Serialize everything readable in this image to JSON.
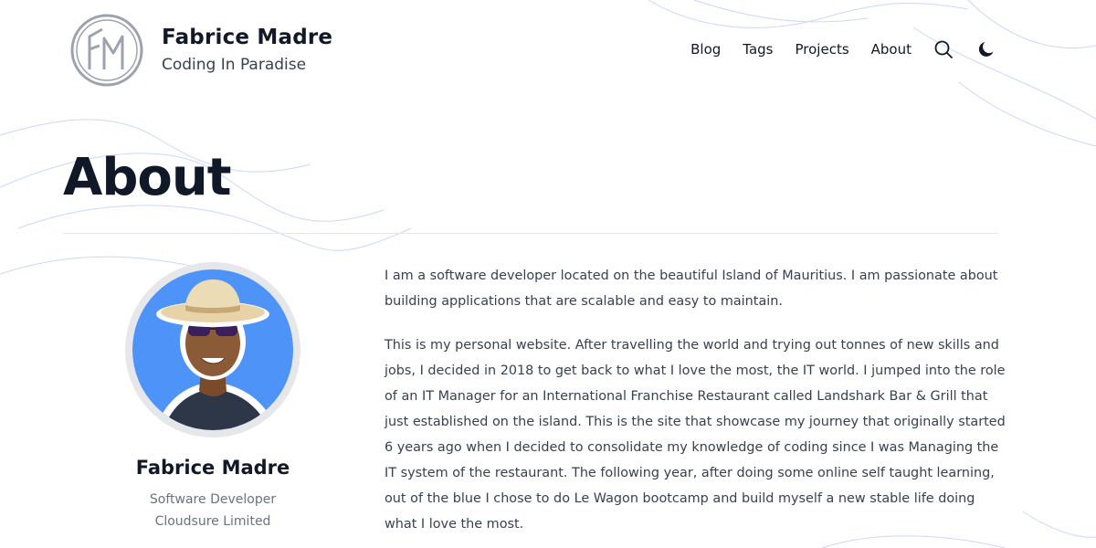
{
  "site": {
    "title": "Fabrice Madre",
    "tagline": "Coding In Paradise",
    "logo_icon": "fm-monogram-logo"
  },
  "nav": {
    "items": [
      "Blog",
      "Tags",
      "Projects",
      "About"
    ],
    "search_icon": "search-icon",
    "theme_icon": "moon-icon"
  },
  "page": {
    "title": "About"
  },
  "profile": {
    "name": "Fabrice Madre",
    "role": "Software Developer",
    "company": "Cloudsure Limited",
    "avatar_bg": "#4e93f7"
  },
  "content": {
    "paragraphs": [
      "I am a software developer located on the beautiful Island of Mauritius. I am passionate about building applications that are scalable and easy to maintain.",
      "This is my personal website. After travelling the world and trying out tonnes of new skills and jobs, I decided in 2018 to get back to what I love the most, the IT world. I jumped into the role of an IT Manager for an International Franchise Restaurant called Landshark Bar & Grill that just established on the island. This is the site that showcase my journey that originally started 6 years ago when I decided to consolidate my knowledge of coding since I was Managing the IT system of the restaurant. The following year, after doing some online self taught learning, out of the blue I chose to do Le Wagon bootcamp and build myself a new stable life doing what I love the most."
    ]
  },
  "colors": {
    "text_dark": "#111827",
    "text_body": "#374151",
    "text_muted": "#6b7280",
    "divider": "#e5e7eb",
    "wave": "#c7d2fe"
  }
}
